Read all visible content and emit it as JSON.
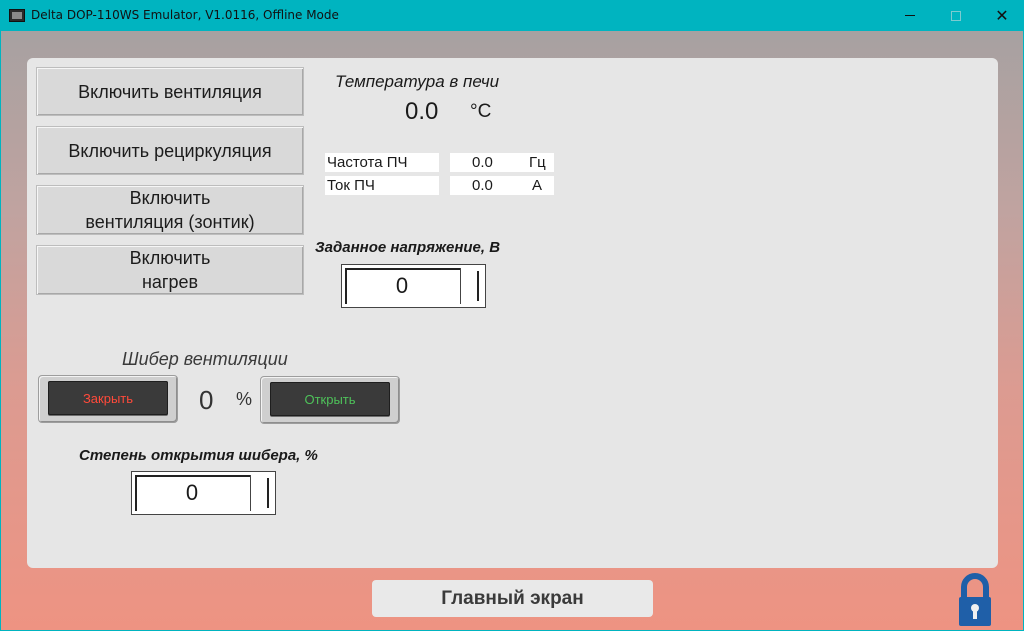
{
  "window": {
    "title": "Delta DOP-110WS Emulator, V1.0116, Offline Mode",
    "minimize_glyph": "",
    "maximize_glyph": "",
    "close_glyph": "✕"
  },
  "buttons": {
    "vent_on": "Включить вентиляция",
    "recirc_on": "Включить рециркуляция",
    "vent_umbrella_on": "Включить\nвентиляция (зонтик)",
    "heat_on": "Включить\nнагрев"
  },
  "furnace": {
    "title": "Температура в печи",
    "value": "0.0",
    "unit": "°C"
  },
  "inverter": {
    "rows": [
      {
        "label": "Частота ПЧ",
        "value": "0.0",
        "unit": "Гц"
      },
      {
        "label": "Ток ПЧ",
        "value": "0.0",
        "unit": "А"
      }
    ]
  },
  "voltage": {
    "title": "Заданное напряжение, В",
    "value": "0"
  },
  "damper": {
    "title": "Шибер вентиляции",
    "close_label": "Закрыть",
    "open_label": "Открыть",
    "position_value": "0",
    "position_unit": "%",
    "close_color": "#ff4a3a",
    "open_color": "#4ec25a"
  },
  "damper_setpoint": {
    "title": "Степень открытия шибера, %",
    "value": "0"
  },
  "footer": {
    "main_screen_label": "Главный экран",
    "lock_icon": "lock-icon",
    "lock_color": "#1f5fa8"
  },
  "colors": {
    "titlebar": "#00b4c0",
    "panel": "#e6e6e6",
    "gradient_bottom": "#ee9382"
  }
}
